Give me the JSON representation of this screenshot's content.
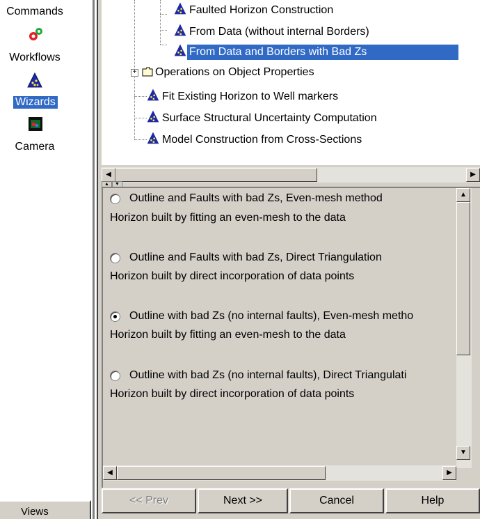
{
  "sidebar": {
    "items": [
      {
        "label": "Commands",
        "icon": "commands-icon"
      },
      {
        "label": "Workflows",
        "icon": "workflows-icon"
      },
      {
        "label": "Wizards",
        "icon": "wizard-icon",
        "selected": true
      },
      {
        "label": "Camera",
        "icon": "camera-icon"
      }
    ],
    "views_label": "Views"
  },
  "tree": {
    "items": [
      {
        "label": "Faulted Horizon Construction",
        "icon": "wizard-icon"
      },
      {
        "label": "From Data (without internal Borders)",
        "icon": "wizard-icon"
      },
      {
        "label": "From Data and Borders with Bad Zs",
        "icon": "wizard-icon",
        "selected": true
      },
      {
        "label": "Operations on Object Properties",
        "icon": "folder-icon"
      },
      {
        "label": "Fit Existing Horizon to Well markers",
        "icon": "wizard-icon"
      },
      {
        "label": "Surface Structural Uncertainty Computation",
        "icon": "wizard-icon"
      },
      {
        "label": "Model Construction from Cross-Sections",
        "icon": "wizard-icon"
      }
    ]
  },
  "options": [
    {
      "label": "Outline and Faults with bad Zs, Even-mesh method",
      "description": "Horizon built by fitting an even-mesh to the data",
      "checked": false
    },
    {
      "label": "Outline and Faults with bad Zs, Direct Triangulation",
      "description": "Horizon built by direct incorporation of data points",
      "checked": false
    },
    {
      "label": "Outline with bad Zs (no internal faults), Even-mesh metho",
      "description": "Horizon built by fitting an even-mesh to the data",
      "checked": true
    },
    {
      "label": "Outline with bad Zs (no internal faults), Direct Triangulati",
      "description": "Horizon built by direct incorporation of data points",
      "checked": false
    }
  ],
  "buttons": {
    "prev": "<< Prev",
    "next": "Next >>",
    "cancel": "Cancel",
    "help": "Help"
  },
  "colors": {
    "selection": "#316ac5",
    "face": "#d4d0c8"
  }
}
